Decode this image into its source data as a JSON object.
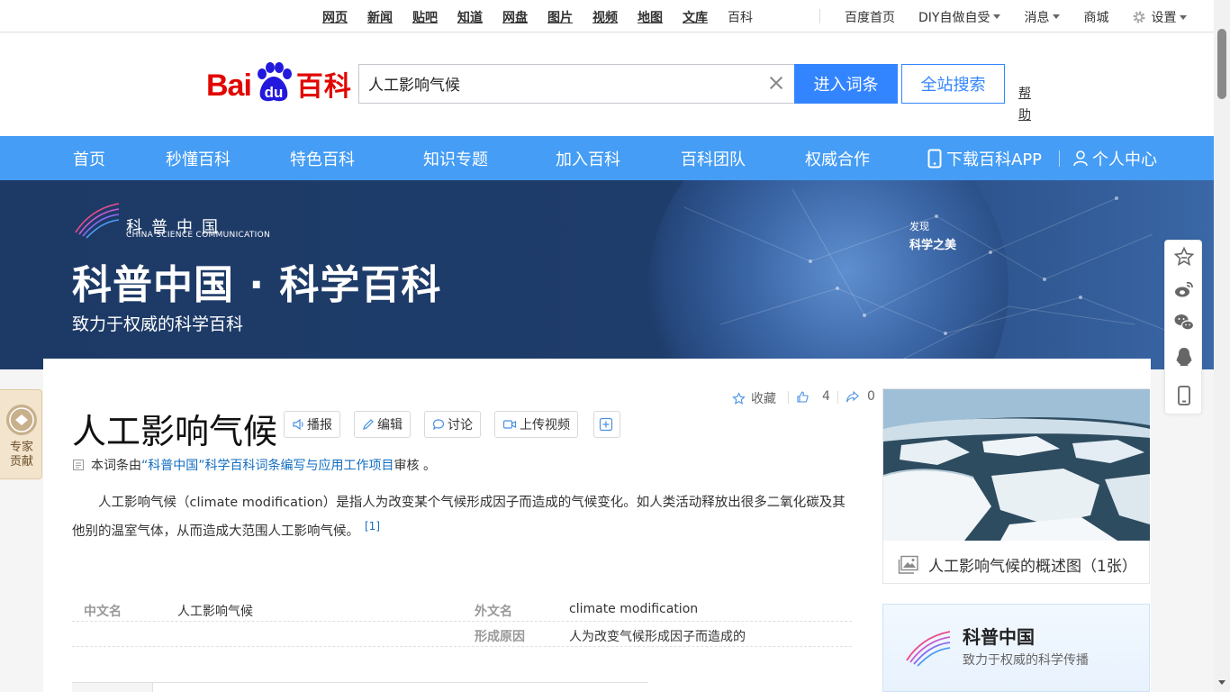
{
  "topnav": {
    "links": [
      "网页",
      "新闻",
      "贴吧",
      "知道",
      "网盘",
      "图片",
      "视频",
      "地图",
      "文库"
    ],
    "current": "百科",
    "right": [
      "百度首页",
      "DIY自做自受",
      "消息",
      "商城",
      "设置"
    ]
  },
  "search": {
    "logo_text": "Bai",
    "logo_du": "du",
    "logo_baike": "百科",
    "query": "人工影响气候",
    "enter_label": "进入词条",
    "all_label": "全站搜索",
    "help_label": "帮助"
  },
  "nav": {
    "items": [
      "首页",
      "秒懂百科",
      "特色百科",
      "知识专题",
      "加入百科",
      "百科团队",
      "权威合作"
    ],
    "app_label": "下载百科APP",
    "user_label": "个人中心"
  },
  "banner": {
    "logo_cn": "科普中国",
    "logo_en": "CHINA SCIENCE COMMUNICATION",
    "title": "科普中国 · 科学百科",
    "subtitle": "致力于权威的科学百科",
    "discover_small": "发现",
    "discover_big": "科学之美"
  },
  "lemma": {
    "title": "人工影响气候",
    "tools": [
      "播报",
      "编辑",
      "讨论",
      "上传视频"
    ],
    "collect_label": "收藏",
    "like_count": "4",
    "share_count": "0",
    "review_prefix": "本词条由",
    "review_link": "“科普中国”科学百科词条编写与应用工作项目",
    "review_suffix": " 审核 。",
    "summary": "人工影响气候（climate modification）是指人为改变某个气候形成因子而造成的气候变化。如人类活动释放出很多二氧化碳及其他别的温室气体，从而造成大范围人工影响气候。",
    "summary_ref": "[1]",
    "basic_info": [
      {
        "key": "中文名",
        "value": "人工影响气候",
        "key2": "外文名",
        "value2": "climate modification"
      },
      {
        "key": "",
        "value": "",
        "key2": "形成原因",
        "value2": "人为改变气候形成因子而造成的"
      }
    ]
  },
  "album": {
    "caption": "人工影响气候的概述图（1张）"
  },
  "kpcard": {
    "title": "科普中国",
    "subtitle": "致力于权威的科学传播"
  },
  "expert": {
    "label": "专家贡献"
  },
  "colors": {
    "nav_bg": "#459df5",
    "primary_btn": "#3385ff",
    "link": "#136ec2",
    "logo_red": "#e10601",
    "banner_bg": "#1d3a66"
  }
}
